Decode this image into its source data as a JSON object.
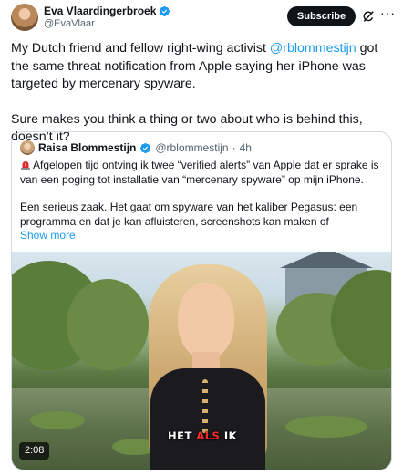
{
  "author": {
    "name": "Eva Vlaardingerbroek",
    "handle": "@EvaVlaar"
  },
  "header": {
    "subscribe_label": "Subscribe",
    "more_label": "···"
  },
  "tweet": {
    "paragraph1_before": "My Dutch friend and fellow right-wing activist ",
    "mention": "@rblommestijn",
    "paragraph1_after": " got the same threat notification from Apple saying her iPhone was targeted by mercenary spyware.",
    "paragraph2": "Sure makes you think a thing or two about who is behind this, doesn’t it?"
  },
  "quote": {
    "name": "Raisa Blommestijn",
    "handle": "@rblommestijn",
    "separator": "·",
    "time": "4h",
    "paragraph1": "Afgelopen tijd ontving ik twee “verified alerts” van Apple dat er sprake is van een poging tot installatie van “mercenary spyware” op mijn iPhone.",
    "paragraph2": "Een serieus zaak. Het gaat om spyware van het kaliber Pegasus: een programma en dat je kan afluisteren, screenshots kan maken of",
    "show_more": "Show more"
  },
  "video": {
    "caption_left": "HET ",
    "caption_mid": "ALS",
    "caption_right": " IK",
    "duration": "2:08"
  },
  "colors": {
    "accent": "#1d9bf0",
    "text": "#0f1419",
    "secondary": "#536471",
    "border": "#cfd9de"
  }
}
